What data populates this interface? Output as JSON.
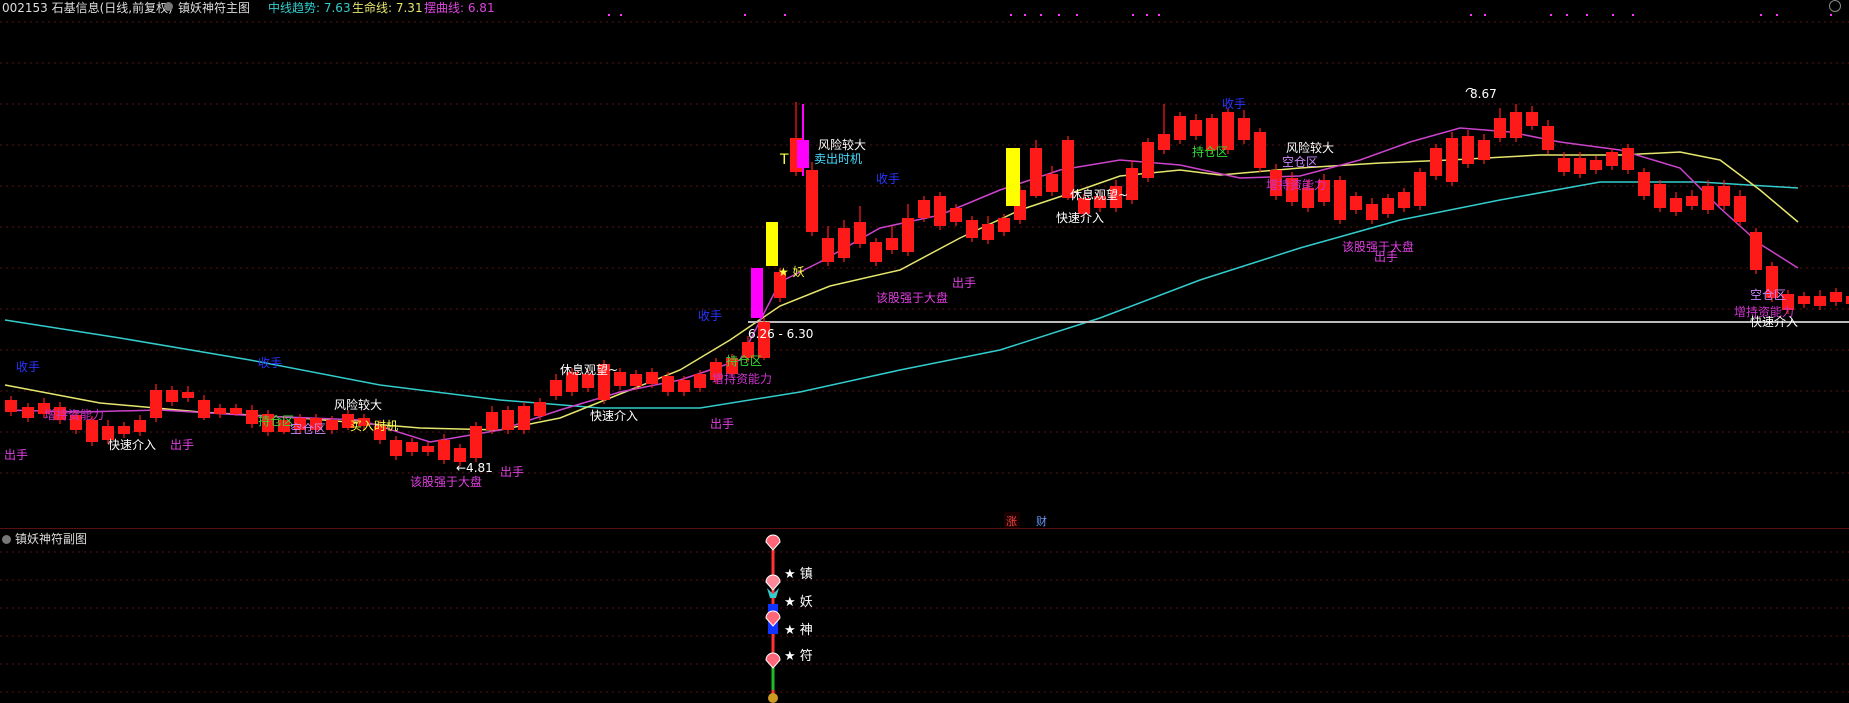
{
  "header": {
    "title": "002153 石基信息(日线,前复权)",
    "indicator_name": "镇妖神符主图",
    "mid_trend_label": "中线趋势: 7.63",
    "life_line_label": "生命线: 7.31",
    "swing_line_label": "摆曲线: 6.81"
  },
  "sub_panel": {
    "title": "镇妖神符副图",
    "stars": [
      "★ 镇",
      "★ 妖",
      "★ 神",
      "★ 符"
    ]
  },
  "price_marks": {
    "low": "←4.81",
    "high": "8.67",
    "range": "6.26 - 6.30"
  },
  "badges": {
    "zhang": "涨",
    "cai": "财"
  },
  "annotations": [
    {
      "text": "收手",
      "color": "#2a35ff"
    },
    {
      "text": "增持资能力",
      "color": "#cc33cc"
    },
    {
      "text": "出手",
      "color": "#e040e0"
    },
    {
      "text": "快速介入",
      "color": "#ffffff"
    },
    {
      "text": "出手",
      "color": "#e040e0"
    },
    {
      "text": "收手",
      "color": "#2a35ff"
    },
    {
      "text": "持仓区",
      "color": "#33dd33"
    },
    {
      "text": "空仓区",
      "color": "#cc88ff"
    },
    {
      "text": "风险较大",
      "color": "#ffffff"
    },
    {
      "text": "买入时机",
      "color": "#ffff44"
    },
    {
      "text": "该股强于大盘",
      "color": "#e040e0"
    },
    {
      "text": "出手",
      "color": "#e040e0"
    },
    {
      "text": "休息观望~",
      "color": "#ffffff"
    },
    {
      "text": "快速介入",
      "color": "#ffffff"
    },
    {
      "text": "出手",
      "color": "#e040e0"
    },
    {
      "text": "收手",
      "color": "#2a35ff"
    },
    {
      "text": "持仓区",
      "color": "#33dd33"
    },
    {
      "text": "增持资能力",
      "color": "#cc33cc"
    },
    {
      "text": "★ 妖",
      "color": "#ffff44"
    },
    {
      "text": "风险较大",
      "color": "#ffffff"
    },
    {
      "text": "卖出时机",
      "color": "#44ddff"
    },
    {
      "text": "收手",
      "color": "#2a35ff"
    },
    {
      "text": "该股强于大盘",
      "color": "#e040e0"
    },
    {
      "text": "出手",
      "color": "#e040e0"
    },
    {
      "text": "休息观望~",
      "color": "#ffffff"
    },
    {
      "text": "快速介入",
      "color": "#ffffff"
    },
    {
      "text": "持仓区",
      "color": "#33dd33"
    },
    {
      "text": "风险较大",
      "color": "#ffffff"
    },
    {
      "text": "空仓区",
      "color": "#cc88ff"
    },
    {
      "text": "增持资能力",
      "color": "#cc33cc"
    },
    {
      "text": "收手",
      "color": "#2a35ff"
    },
    {
      "text": "该股强于大盘",
      "color": "#e040e0"
    },
    {
      "text": "出手",
      "color": "#e040e0"
    },
    {
      "text": "空仓区",
      "color": "#cc88ff"
    },
    {
      "text": "增持资能力",
      "color": "#cc33cc"
    },
    {
      "text": "快速介入",
      "color": "#ffffff"
    }
  ],
  "colors": {
    "background": "#000000",
    "up_candle": "#ff1a1a",
    "yao_bar": "#ff00ff",
    "zhen_bar": "#ffff00",
    "mid_trend": "#33cccc",
    "life_line": "#e6e66e",
    "swing_line": "#cc44cc",
    "mid_trend_text": "#33cccc",
    "life_line_text": "#e6e66e",
    "swing_line_text": "#dd44dd",
    "grid": "#5a1212"
  }
}
